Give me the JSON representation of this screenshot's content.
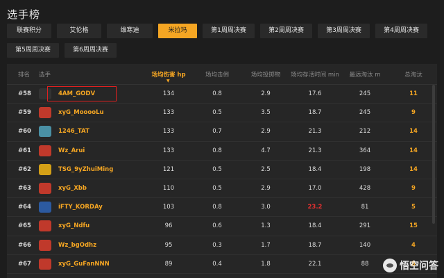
{
  "page_title": "选手榜",
  "tabs": [
    {
      "label": "联赛积分",
      "active": false
    },
    {
      "label": "艾伦格",
      "active": false
    },
    {
      "label": "维寒迪",
      "active": false
    },
    {
      "label": "米拉玛",
      "active": true
    },
    {
      "label": "第1周周决赛",
      "active": false
    },
    {
      "label": "第2周周决赛",
      "active": false
    },
    {
      "label": "第3周周决赛",
      "active": false
    },
    {
      "label": "第4周周决赛",
      "active": false
    },
    {
      "label": "第5周周决赛",
      "active": false
    },
    {
      "label": "第6周周决赛",
      "active": false
    }
  ],
  "table": {
    "headers": {
      "rank": "排名",
      "player": "选手",
      "avg_damage": "场均伤害 hp",
      "avg_knock": "场均击倒",
      "avg_throw": "场均投掷物",
      "avg_survival": "场均存活时间 min",
      "farthest_kill": "最远淘汰 m",
      "total_kills": "总淘汰"
    },
    "rows": [
      {
        "rank": "#58",
        "player": "4AM_GODV",
        "team_logo": "4am-logo",
        "logo_color": "#333333",
        "avg_damage": "134",
        "avg_knock": "0.8",
        "avg_throw": "2.9",
        "avg_survival": "17.6",
        "farthest_kill": "245",
        "total_kills": "11"
      },
      {
        "rank": "#59",
        "player": "xyG_MooooLu",
        "team_logo": "xyg-logo",
        "logo_color": "#c0392b",
        "avg_damage": "133",
        "avg_knock": "0.5",
        "avg_throw": "3.5",
        "avg_survival": "18.7",
        "farthest_kill": "245",
        "total_kills": "9"
      },
      {
        "rank": "#60",
        "player": "1246_TAT",
        "team_logo": "1246-logo",
        "logo_color": "#4a90a4",
        "avg_damage": "133",
        "avg_knock": "0.7",
        "avg_throw": "2.9",
        "avg_survival": "21.3",
        "farthest_kill": "212",
        "total_kills": "14"
      },
      {
        "rank": "#61",
        "player": "Wz_Arui",
        "team_logo": "wz-logo",
        "logo_color": "#c0392b",
        "avg_damage": "133",
        "avg_knock": "0.8",
        "avg_throw": "4.7",
        "avg_survival": "21.3",
        "farthest_kill": "364",
        "total_kills": "14"
      },
      {
        "rank": "#62",
        "player": "TSG_9yZhuiMing",
        "team_logo": "tsg-logo",
        "logo_color": "#d4a017",
        "avg_damage": "121",
        "avg_knock": "0.5",
        "avg_throw": "2.5",
        "avg_survival": "18.4",
        "farthest_kill": "198",
        "total_kills": "14"
      },
      {
        "rank": "#63",
        "player": "xyG_Xbb",
        "team_logo": "xyg-logo",
        "logo_color": "#c0392b",
        "avg_damage": "110",
        "avg_knock": "0.5",
        "avg_throw": "2.9",
        "avg_survival": "17.0",
        "farthest_kill": "428",
        "total_kills": "9"
      },
      {
        "rank": "#64",
        "player": "iFTY_KORDAy",
        "team_logo": "ifty-logo",
        "logo_color": "#2c5aa0",
        "avg_damage": "103",
        "avg_knock": "0.8",
        "avg_throw": "3.0",
        "avg_survival": "23.2",
        "avg_survival_highlight": true,
        "farthest_kill": "81",
        "total_kills": "5"
      },
      {
        "rank": "#65",
        "player": "xyG_Ndfu",
        "team_logo": "xyg-logo",
        "logo_color": "#c0392b",
        "avg_damage": "96",
        "avg_knock": "0.6",
        "avg_throw": "1.3",
        "avg_survival": "18.4",
        "farthest_kill": "291",
        "total_kills": "15"
      },
      {
        "rank": "#66",
        "player": "Wz_bgOdhz",
        "team_logo": "wz-logo",
        "logo_color": "#c0392b",
        "avg_damage": "95",
        "avg_knock": "0.3",
        "avg_throw": "1.7",
        "avg_survival": "18.7",
        "farthest_kill": "140",
        "total_kills": "4"
      },
      {
        "rank": "#67",
        "player": "xyG_GuFanNNN",
        "team_logo": "xyg-logo",
        "logo_color": "#c0392b",
        "avg_damage": "89",
        "avg_knock": "0.4",
        "avg_throw": "1.8",
        "avg_survival": "22.1",
        "farthest_kill": "88",
        "total_kills": "8"
      }
    ]
  },
  "watermark": "悟空问答",
  "colors": {
    "accent": "#f5a623",
    "highlight_box": "#e02020",
    "red_value": "#e03030",
    "background": "#1d1d1d"
  }
}
